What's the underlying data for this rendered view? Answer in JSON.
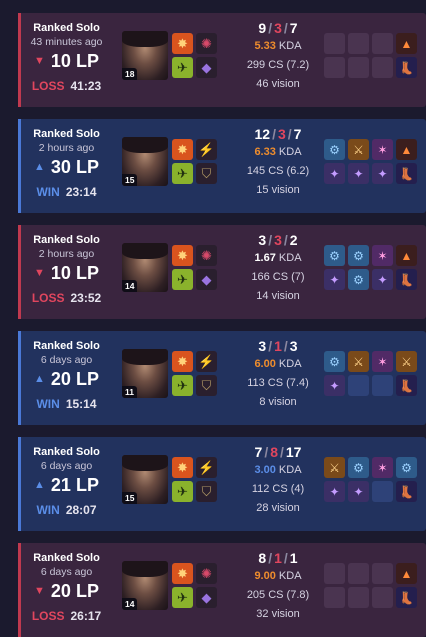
{
  "matches": [
    {
      "outcome": "loss",
      "queue": "Ranked Solo",
      "time_ago": "43 minutes ago",
      "lp_arrow": "▼",
      "lp": "10 LP",
      "result": "LOSS",
      "duration": "41:23",
      "level": "18",
      "kills": "9",
      "deaths": "3",
      "assists": "7",
      "kda": "5.33",
      "kda_color": "gold",
      "kda_label": "KDA",
      "cs": "299 CS (7.2)",
      "vision": "46 vision",
      "spells": [
        "flash-icon",
        "ghost-icon"
      ],
      "runes": [
        "conqueror-icon",
        "sorcery-icon"
      ],
      "items": [
        "",
        "",
        "",
        "ward-icon",
        "",
        "",
        "",
        "boots-icon"
      ]
    },
    {
      "outcome": "win",
      "queue": "Ranked Solo",
      "time_ago": "2 hours ago",
      "lp_arrow": "▲",
      "lp": "30 LP",
      "result": "WIN",
      "duration": "23:14",
      "level": "15",
      "kills": "12",
      "deaths": "3",
      "assists": "7",
      "kda": "6.33",
      "kda_color": "gold",
      "kda_label": "KDA",
      "cs": "145 CS (6.2)",
      "vision": "15 vision",
      "spells": [
        "flash-icon",
        "ghost-icon"
      ],
      "runes": [
        "electrocute-icon",
        "resolve-icon"
      ],
      "items": [
        "item-a",
        "item-c",
        "item-d",
        "ward-icon",
        "item-b",
        "item-b",
        "item-b",
        "boots-icon"
      ]
    },
    {
      "outcome": "loss",
      "queue": "Ranked Solo",
      "time_ago": "2 hours ago",
      "lp_arrow": "▼",
      "lp": "10 LP",
      "result": "LOSS",
      "duration": "23:52",
      "level": "14",
      "kills": "3",
      "deaths": "3",
      "assists": "2",
      "kda": "1.67",
      "kda_color": "white",
      "kda_label": "KDA",
      "cs": "166 CS (7)",
      "vision": "14 vision",
      "spells": [
        "flash-icon",
        "ghost-icon"
      ],
      "runes": [
        "conqueror-icon",
        "sorcery-icon"
      ],
      "items": [
        "item-a",
        "item-a",
        "item-d",
        "ward-icon",
        "item-b",
        "item-a",
        "item-b",
        "boots-icon"
      ]
    },
    {
      "outcome": "win",
      "queue": "Ranked Solo",
      "time_ago": "6 days ago",
      "lp_arrow": "▲",
      "lp": "20 LP",
      "result": "WIN",
      "duration": "15:14",
      "level": "11",
      "kills": "3",
      "deaths": "1",
      "assists": "3",
      "kda": "6.00",
      "kda_color": "gold",
      "kda_label": "KDA",
      "cs": "113 CS (7.4)",
      "vision": "8 vision",
      "spells": [
        "flash-icon",
        "ghost-icon"
      ],
      "runes": [
        "electrocute-icon",
        "resolve-icon"
      ],
      "items": [
        "item-a",
        "item-c",
        "item-d",
        "item-c",
        "item-b",
        "",
        "",
        "boots-icon"
      ]
    },
    {
      "outcome": "win",
      "queue": "Ranked Solo",
      "time_ago": "6 days ago",
      "lp_arrow": "▲",
      "lp": "21 LP",
      "result": "WIN",
      "duration": "28:07",
      "level": "15",
      "kills": "7",
      "deaths": "8",
      "assists": "17",
      "kda": "3.00",
      "kda_color": "blue",
      "kda_label": "KDA",
      "cs": "112 CS (4)",
      "vision": "28 vision",
      "spells": [
        "flash-icon",
        "ghost-icon"
      ],
      "runes": [
        "electrocute-icon",
        "resolve-icon"
      ],
      "items": [
        "item-c",
        "item-a",
        "item-d",
        "item-a",
        "item-b",
        "item-b",
        "",
        "boots-icon"
      ]
    },
    {
      "outcome": "loss",
      "queue": "Ranked Solo",
      "time_ago": "6 days ago",
      "lp_arrow": "▼",
      "lp": "20 LP",
      "result": "LOSS",
      "duration": "26:17",
      "level": "14",
      "kills": "8",
      "deaths": "1",
      "assists": "1",
      "kda": "9.00",
      "kda_color": "gold",
      "kda_label": "KDA",
      "cs": "205 CS (7.8)",
      "vision": "32 vision",
      "spells": [
        "flash-icon",
        "ghost-icon"
      ],
      "runes": [
        "conqueror-icon",
        "sorcery-icon"
      ],
      "items": [
        "",
        "",
        "",
        "ward-icon",
        "",
        "",
        "",
        "boots-icon"
      ]
    }
  ]
}
